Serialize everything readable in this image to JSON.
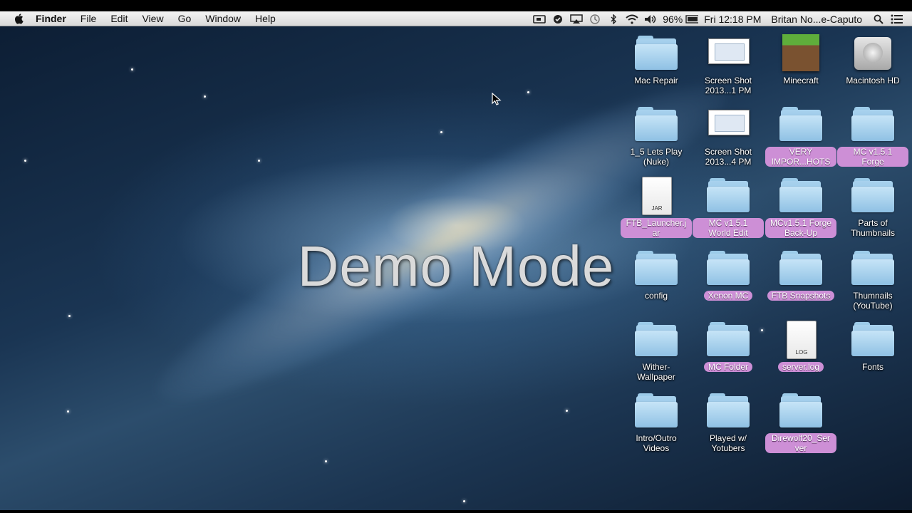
{
  "menubar": {
    "apple_icon": "apple-logo-icon",
    "items": [
      "Finder",
      "File",
      "Edit",
      "View",
      "Go",
      "Window",
      "Help"
    ],
    "status": {
      "battery": "96%",
      "clock": "Fri 12:18 PM",
      "user": "Britan No...e-Caputo",
      "icons": [
        "screen-record-icon",
        "evernote-icon",
        "airplay-icon",
        "time-machine-icon",
        "bluetooth-icon",
        "wifi-icon",
        "volume-icon",
        "battery-icon",
        "spotlight-icon",
        "notification-center-icon"
      ]
    }
  },
  "overlay": {
    "text": "Demo Mode"
  },
  "desktop": {
    "tag_color": "#cd8fd6",
    "folder_color": "#9ccbe9",
    "icons": [
      {
        "name": "mac-repair-folder",
        "label": "Mac Repair",
        "type": "folder",
        "tag": false
      },
      {
        "name": "screen-shot-1-file",
        "label": "Screen Shot 2013...1 PM",
        "type": "screenshot",
        "tag": false
      },
      {
        "name": "minecraft-app",
        "label": "Minecraft",
        "type": "minecraft",
        "tag": false
      },
      {
        "name": "macintosh-hd-drive",
        "label": "Macintosh HD",
        "type": "harddrive",
        "tag": false
      },
      {
        "name": "lets-play-nuke-folder",
        "label": "1_5 Lets Play (Nuke)",
        "type": "folder",
        "tag": false
      },
      {
        "name": "screen-shot-4-file",
        "label": "Screen Shot 2013...4 PM",
        "type": "screenshot",
        "tag": false
      },
      {
        "name": "very-important-hots-folder",
        "label": "VERY IMPOR...HOTS",
        "type": "folder",
        "tag": true
      },
      {
        "name": "mc-forge-folder",
        "label": "MC v1.5.1 Forge",
        "type": "folder",
        "tag": true
      },
      {
        "name": "ftb-launcher-jar",
        "label": "FTB_Launcher.jar",
        "type": "jar",
        "docText": "JAR",
        "tag": true
      },
      {
        "name": "mc-world-edit-folder",
        "label": "MC v1.5.1 World Edit",
        "type": "folder",
        "tag": true
      },
      {
        "name": "mc-forge-backup-folder",
        "label": "MCv1.5.1 Forge Back-Up",
        "type": "folder",
        "tag": true
      },
      {
        "name": "parts-of-thumbnails-folder",
        "label": "Parts of Thumbnails",
        "type": "folder",
        "tag": false
      },
      {
        "name": "config-folder",
        "label": "config",
        "type": "folder",
        "tag": false
      },
      {
        "name": "xenon-mc-folder",
        "label": "Xenon MC",
        "type": "folder",
        "tag": true
      },
      {
        "name": "ftb-snapshots-folder",
        "label": "FTB Snapshots",
        "type": "folder",
        "tag": true
      },
      {
        "name": "thumnails-youtube-folder",
        "label": "Thumnails (YouTube)",
        "type": "folder",
        "tag": false
      },
      {
        "name": "wither-wallpaper-folder",
        "label": "Wither-Wallpaper",
        "type": "folder",
        "tag": false
      },
      {
        "name": "mc-folder",
        "label": "MC Folder",
        "type": "folder",
        "tag": true
      },
      {
        "name": "server-log-file",
        "label": "server.log",
        "type": "log",
        "docText": "LOG",
        "tag": true
      },
      {
        "name": "fonts-folder",
        "label": "Fonts",
        "type": "folder",
        "tag": false
      },
      {
        "name": "intro-outro-videos-folder",
        "label": "Intro/Outro Videos",
        "type": "folder",
        "tag": false
      },
      {
        "name": "played-with-yotubers-folder",
        "label": "Played w/ Yotubers",
        "type": "folder",
        "tag": false
      },
      {
        "name": "direwolf20-server-folder",
        "label": "Direwolf20_Server",
        "type": "folder",
        "tag": true
      }
    ]
  }
}
